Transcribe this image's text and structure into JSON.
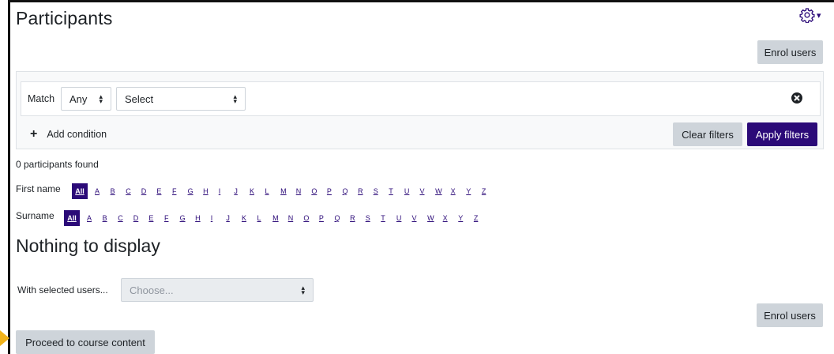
{
  "header": {
    "title": "Participants",
    "gear_icon": "gear-icon",
    "caret": "▾"
  },
  "enrol_button_top": "Enrol users",
  "filter": {
    "match_label": "Match",
    "match_value": "Any",
    "field_select_value": "Select",
    "remove_icon": "close-circle-icon",
    "add_condition_label": "Add condition",
    "clear_label": "Clear filters",
    "apply_label": "Apply filters"
  },
  "results": {
    "count_text": "0 participants found"
  },
  "initials": {
    "first_name_label": "First name",
    "surname_label": "Surname",
    "all_label": "All",
    "letters": [
      "A",
      "B",
      "C",
      "D",
      "E",
      "F",
      "G",
      "H",
      "I",
      "J",
      "K",
      "L",
      "M",
      "N",
      "O",
      "P",
      "Q",
      "R",
      "S",
      "T",
      "U",
      "V",
      "W",
      "X",
      "Y",
      "Z"
    ]
  },
  "empty_heading": "Nothing to display",
  "bulk": {
    "label": "With selected users...",
    "placeholder": "Choose..."
  },
  "enrol_button_bottom": "Enrol users",
  "proceed_button": "Proceed to course content",
  "colors": {
    "primary": "#2b0a78",
    "secondary_button": "#ced4da",
    "marker": "#f0b21a"
  }
}
